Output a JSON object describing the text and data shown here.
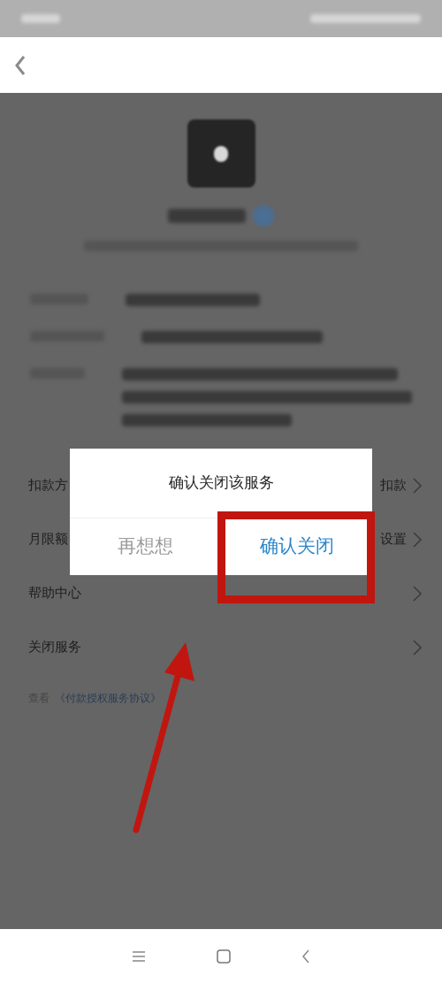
{
  "menu_rows": [
    {
      "label": "扣款方",
      "value": "扣款"
    },
    {
      "label": "月限额",
      "value": "设置"
    },
    {
      "label": "帮助中心"
    },
    {
      "label": "关闭服务"
    }
  ],
  "agreement": {
    "prefix": "查看",
    "link": "《付款授权服务协议》"
  },
  "dialog": {
    "title": "确认关闭该服务",
    "buttons": [
      {
        "label": "再想想",
        "kind": "cancel"
      },
      {
        "label": "确认关闭",
        "kind": "confirm"
      }
    ]
  }
}
